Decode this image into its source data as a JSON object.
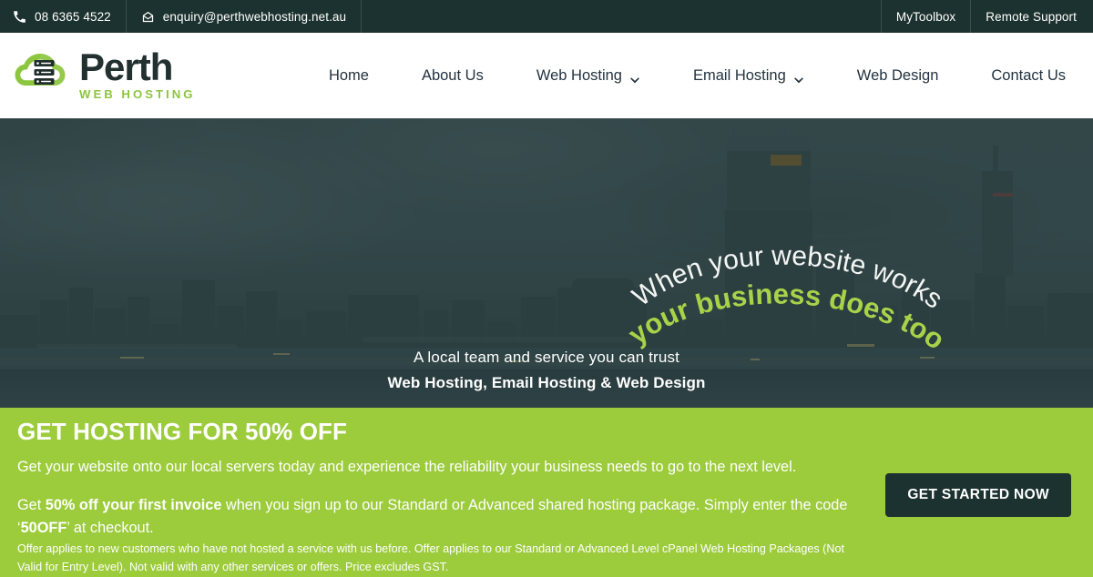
{
  "topbar": {
    "phone": "08 6365 4522",
    "email": "enquiry@perthwebhosting.net.au",
    "phone_icon": "phone-icon",
    "email_icon": "envelope-icon",
    "links": [
      {
        "label": "MyToolbox"
      },
      {
        "label": "Remote Support"
      }
    ]
  },
  "header": {
    "logo": {
      "title": "Perth",
      "subtitle": "WEB HOSTING",
      "icon": "cloud-server-logo-icon"
    },
    "nav": [
      {
        "label": "Home",
        "has_dropdown": false
      },
      {
        "label": "About Us",
        "has_dropdown": false
      },
      {
        "label": "Web Hosting",
        "has_dropdown": true
      },
      {
        "label": "Email Hosting",
        "has_dropdown": true
      },
      {
        "label": "Web Design",
        "has_dropdown": false
      },
      {
        "label": "Contact Us",
        "has_dropdown": false
      }
    ]
  },
  "hero": {
    "arc_line_1": "When your website works",
    "arc_line_2": "your business does too",
    "center_line_1": "A local team and service you can trust",
    "center_line_2": "Web Hosting, Email Hosting & Web Design",
    "background_alt": "perth-city-skyline-at-dusk"
  },
  "promo": {
    "title": "GET HOSTING FOR 50% OFF",
    "lede": "Get your website onto our local servers today and experience the reliability your business needs to go to the next level.",
    "body_1": "Get ",
    "body_bold_1": "50% off your first invoice",
    "body_2": " when you sign up to our Standard or Advanced shared hosting package. Simply enter the code ‘",
    "body_bold_2": "50OFF",
    "body_3": "’ at checkout.",
    "cta_label": "GET STARTED NOW",
    "fine_print": "Offer applies to new customers who have not hosted a service with us before. Offer applies to our Standard or Advanced Level cPanel Web Hosting Packages (Not Valid for Entry Level). Not valid with any other services or offers. Price excludes GST."
  },
  "colors": {
    "brand_green": "#9ccb3c",
    "accent_green_text": "#a9d24a",
    "logo_green": "#8cc63f",
    "dark_teal": "#1c3230",
    "nav_text": "#23333f"
  }
}
